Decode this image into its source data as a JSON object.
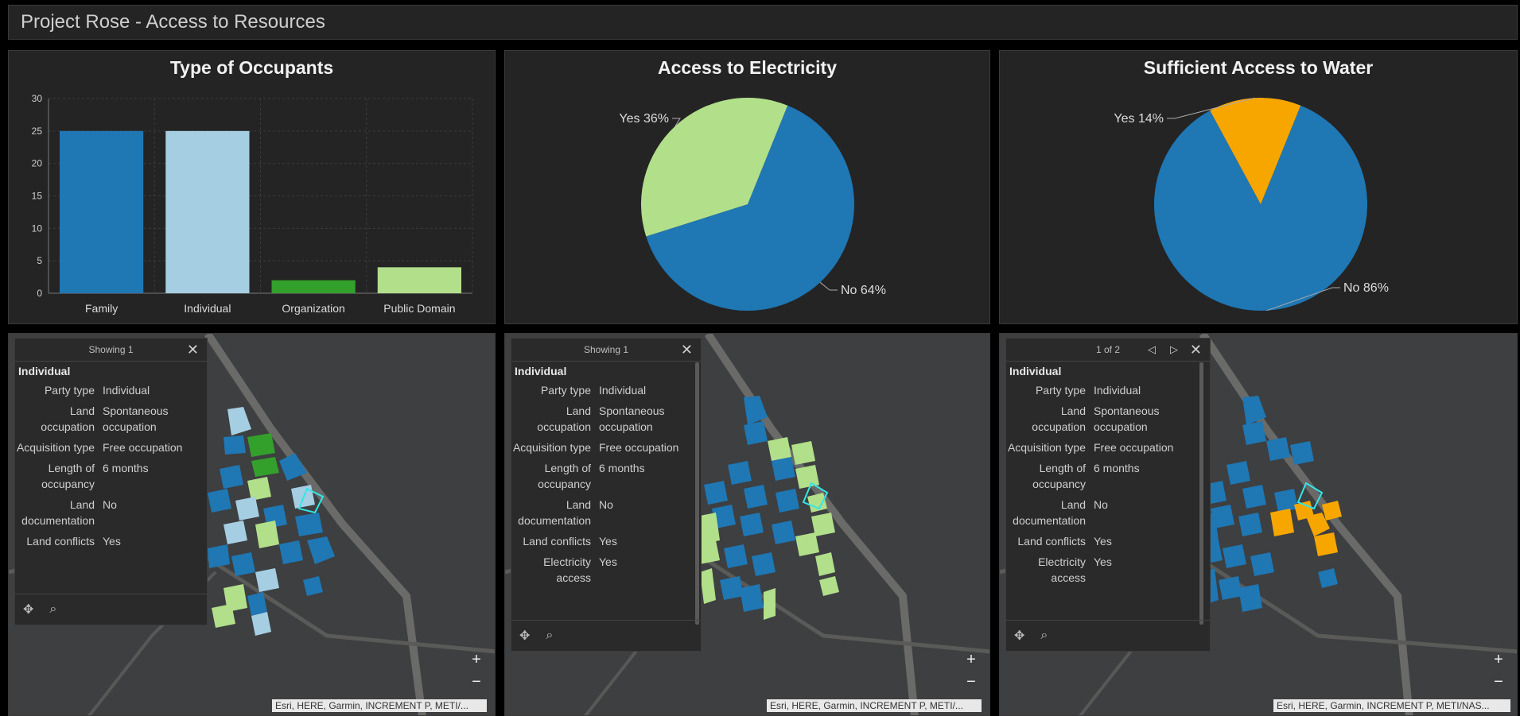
{
  "app": {
    "title": "Project Rose - Access to Resources"
  },
  "colors": {
    "background": "#000000",
    "panel": "#242424",
    "blue": "#1f77b4",
    "light_blue": "#a6cee3",
    "green": "#33a02c",
    "light_green": "#b2df8a",
    "orange": "#f7a600",
    "highlight": "#33e6e6"
  },
  "charts": {
    "occupants": {
      "title": "Type of Occupants"
    },
    "electricity": {
      "title": "Access to Electricity",
      "yes_label": "Yes 36%",
      "no_label": "No 64%"
    },
    "water": {
      "title": "Sufficient Access to Water",
      "yes_label": "Yes 14%",
      "no_label": "No 86%"
    }
  },
  "chart_data": [
    {
      "type": "bar",
      "title": "Type of Occupants",
      "categories": [
        "Family",
        "Individual",
        "Organization",
        "Public Domain"
      ],
      "values": [
        25,
        25,
        2,
        4
      ],
      "colors": [
        "#1f77b4",
        "#a6cee3",
        "#33a02c",
        "#b2df8a"
      ],
      "ylim": [
        0,
        30
      ],
      "yticks": [
        "0",
        "5",
        "10",
        "15",
        "20",
        "25",
        "30"
      ],
      "grid": true
    },
    {
      "type": "pie",
      "title": "Access to Electricity",
      "labels": [
        "Yes",
        "No"
      ],
      "values": [
        36,
        64
      ],
      "colors": [
        "#b2df8a",
        "#1f77b4"
      ]
    },
    {
      "type": "pie",
      "title": "Sufficient Access to Water",
      "labels": [
        "Yes",
        "No"
      ],
      "values": [
        14,
        86
      ],
      "colors": [
        "#f7a600",
        "#1f77b4"
      ]
    }
  ],
  "popups": [
    {
      "header": "Showing 1",
      "title": "Individual",
      "fields": [
        {
          "k": "Party type",
          "v": "Individual"
        },
        {
          "k": "Land occupation",
          "v": "Spontaneous occupation"
        },
        {
          "k": "Acquisition type",
          "v": "Free occupation"
        },
        {
          "k": "Length of occupancy",
          "v": "6 months"
        },
        {
          "k": "Land documentation",
          "v": "No"
        },
        {
          "k": "Land conflicts",
          "v": "Yes"
        }
      ]
    },
    {
      "header": "Showing 1",
      "title": "Individual",
      "fields": [
        {
          "k": "Party type",
          "v": "Individual"
        },
        {
          "k": "Land occupation",
          "v": "Spontaneous occupation"
        },
        {
          "k": "Acquisition type",
          "v": "Free occupation"
        },
        {
          "k": "Length of occupancy",
          "v": "6 months"
        },
        {
          "k": "Land documentation",
          "v": "No"
        },
        {
          "k": "Land conflicts",
          "v": "Yes"
        },
        {
          "k": "Electricity access",
          "v": "Yes"
        }
      ]
    },
    {
      "header": "1 of 2",
      "title": "Individual",
      "fields": [
        {
          "k": "Party type",
          "v": "Individual"
        },
        {
          "k": "Land occupation",
          "v": "Spontaneous occupation"
        },
        {
          "k": "Acquisition type",
          "v": "Free occupation"
        },
        {
          "k": "Length of occupancy",
          "v": "6 months"
        },
        {
          "k": "Land documentation",
          "v": "No"
        },
        {
          "k": "Land conflicts",
          "v": "Yes"
        },
        {
          "k": "Electricity access",
          "v": "Yes"
        }
      ]
    }
  ],
  "maps": {
    "zoom_in": "+",
    "zoom_out": "−",
    "attributions": [
      "Esri, HERE, Garmin, INCREMENT P, METI/...",
      "Esri, HERE, Garmin, INCREMENT P, METI/...",
      "Esri, HERE, Garmin, INCREMENT P, METI/NAS..."
    ]
  },
  "icons": {
    "close": "close-icon",
    "prev": "chevron-left-icon",
    "next": "chevron-right-icon",
    "pan": "pan-icon",
    "zoom_to": "zoom-to-icon"
  }
}
